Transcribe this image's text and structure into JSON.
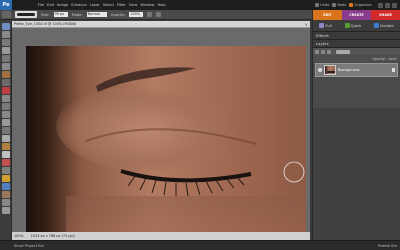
{
  "app": {
    "logo": "Pe",
    "menu": [
      "File",
      "Edit",
      "Image",
      "Enhance",
      "Layer",
      "Select",
      "Filter",
      "View",
      "Window",
      "Help"
    ],
    "right": [
      {
        "label": "Undo",
        "icon": "undo-icon"
      },
      {
        "label": "Redo",
        "icon": "redo-icon"
      },
      {
        "label": "Organizer",
        "icon": "organizer-icon"
      }
    ]
  },
  "options": {
    "size_label": "Size:",
    "size_value": "99 px",
    "mode_label": "Mode:",
    "mode_value": "Normal",
    "opacity_label": "Opacity:",
    "opacity_value": "100%"
  },
  "document": {
    "title": "Pretty_Eye_1000.tif @ 100% (RGB/8)",
    "zoom": "100%",
    "dimensions": "1024 px x 768 px (72 ppi)"
  },
  "panel": {
    "mode_tabs": [
      {
        "label": "EDIT",
        "color": "#d9731c"
      },
      {
        "label": "CREATE",
        "color": "#8a3c8c"
      },
      {
        "label": "SHARE",
        "color": "#d42a2a"
      }
    ],
    "subtabs": [
      "Full",
      "Quick",
      "Guided"
    ],
    "effects_header": "Effects",
    "layers_header": "Layers",
    "blend_mode": "Normal",
    "opacity_label": "Opacity:",
    "lock_label": "Lock:",
    "layer_name": "Background"
  },
  "status": {
    "left": "Show Project Bin",
    "right": "Palette Bin"
  },
  "colors": {
    "edit_tab": "#d9731c",
    "create_tab": "#8a3c8c",
    "share_tab": "#d42a2a"
  }
}
